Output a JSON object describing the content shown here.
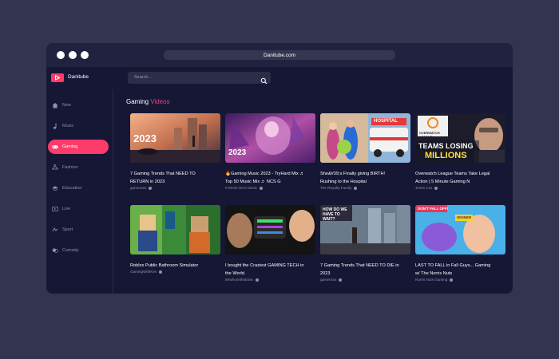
{
  "browser": {
    "url": "Danitube.com"
  },
  "brand": {
    "name": "Danitube",
    "accent": "#ff3b6b"
  },
  "search": {
    "placeholder": "Search..."
  },
  "sidebar": {
    "items": [
      {
        "label": "New",
        "icon": "home-icon"
      },
      {
        "label": "Music",
        "icon": "music-note-icon"
      },
      {
        "label": "Gaming",
        "icon": "gamepad-icon",
        "active": true
      },
      {
        "label": "Fashion",
        "icon": "hanger-icon"
      },
      {
        "label": "Education",
        "icon": "graduation-cap-icon"
      },
      {
        "label": "Live",
        "icon": "live-tv-icon"
      },
      {
        "label": "Sport",
        "icon": "sport-icon"
      },
      {
        "label": "Comedy",
        "icon": "comedy-icon"
      }
    ]
  },
  "section": {
    "title": "Gaming",
    "subtitle": "Videos"
  },
  "videos": [
    {
      "title_l1": "7 Gaming Trends That NEED TO",
      "title_l2": "RETURN in 2023",
      "channel": "gameranx",
      "thumb_text": "2023"
    },
    {
      "title_l1": "🔥Gaming Music 2023 - TryHard Mix ♬",
      "title_l2": "Top 50 Music Mix ♬ NCS G",
      "channel": "Freeme NCS Music",
      "thumb_text": "2023"
    },
    {
      "title_l1": "She&#39;s Finally giving BIRTH!",
      "title_l2": "Rushing to the Hospital",
      "channel": "The Royalty Family",
      "thumb_text": "HOSPITAL"
    },
    {
      "title_l1": "Overwatch League Teams Take Legal",
      "title_l2": "Action | 5 Minute Gaming N",
      "channel": "Jesse Cox",
      "thumb_text_1": "OVERWATCH LEAGUE",
      "thumb_text_2": "TEAMS LOSING",
      "thumb_text_3": "MILLIONS"
    },
    {
      "title_l1": "Roblox Public Bathroom Simulator",
      "title_l2": "",
      "channel": "GamingWithKev"
    },
    {
      "title_l1": "I bought the Craziest GAMING TECH in",
      "title_l2": "the World.",
      "channel": "Mrwhosetheboss"
    },
    {
      "title_l1": "7 Gaming Trends That NEED TO DIE in",
      "title_l2": "2023",
      "channel": "gameranx",
      "thumb_text": "HOW DO WE HAVE TO WAIT?"
    },
    {
      "title_l1": "LAST TO FALL in Fall Guys... Gaming",
      "title_l2": "w/ The Norris Nuts",
      "channel": "Norris Nuts Gaming",
      "thumb_text_1": "DON'T FALL OFF!",
      "thumb_text_2": "WINNER"
    }
  ]
}
